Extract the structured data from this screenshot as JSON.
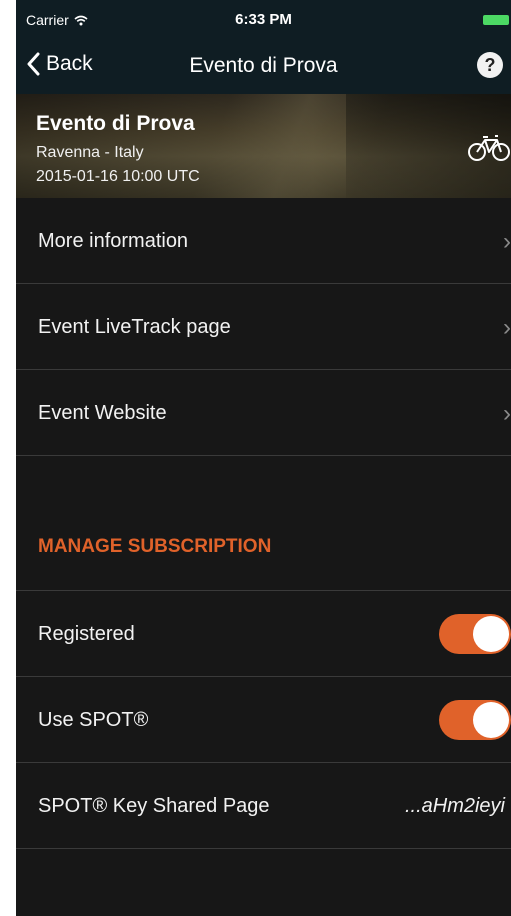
{
  "status": {
    "carrier": "Carrier",
    "time": "6:33 PM"
  },
  "nav": {
    "back_label": "Back",
    "title": "Evento di Prova",
    "help": "?"
  },
  "event": {
    "name": "Evento di Prova",
    "location": "Ravenna - Italy",
    "date": "2015-01-16 10:00 UTC",
    "sport_icon": "bicycle-icon"
  },
  "links": [
    {
      "label": "More information"
    },
    {
      "label": "Event LiveTrack page"
    },
    {
      "label": "Event Website"
    }
  ],
  "subscription": {
    "header": "MANAGE SUBSCRIPTION",
    "registered_label": "Registered",
    "registered_on": true,
    "spot_label": "Use SPOT®",
    "spot_on": true,
    "key_label": "SPOT® Key Shared Page",
    "key_value": "...aHm2ieyi"
  },
  "colors": {
    "accent": "#e0622a",
    "navbar": "#0f1d23",
    "background": "#171717"
  }
}
